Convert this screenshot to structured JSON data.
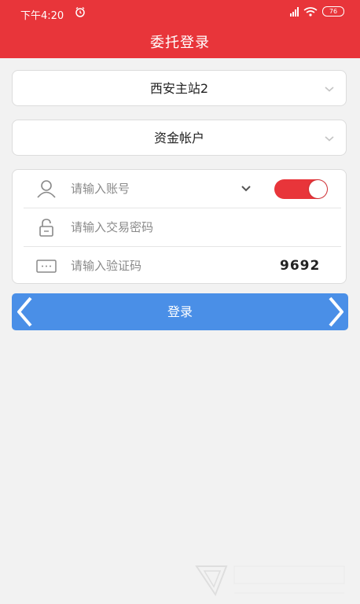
{
  "status_bar": {
    "time": "下午4:20",
    "battery": "76",
    "icons": [
      "alarm-icon",
      "signal-icon",
      "wifi-icon",
      "battery-icon"
    ]
  },
  "header": {
    "title": "委托登录",
    "color": "#e8353a"
  },
  "server_select": {
    "value": "西安主站2"
  },
  "account_type_select": {
    "value": "资金帐户"
  },
  "form": {
    "account_placeholder": "请输入账号",
    "password_placeholder": "请输入交易密码",
    "captcha_placeholder": "请输入验证码",
    "captcha_code": "9692",
    "remember_toggle_on": true
  },
  "login_button": {
    "label": "登录",
    "color": "#4a8fe7"
  }
}
